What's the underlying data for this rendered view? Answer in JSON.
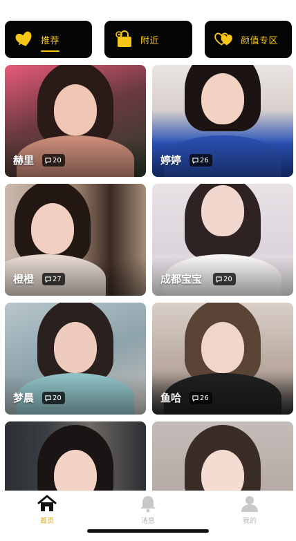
{
  "tabs": [
    {
      "label": "推荐",
      "icon": "heart-icon",
      "active": true
    },
    {
      "label": "附近",
      "icon": "location-bag-icon",
      "active": false
    },
    {
      "label": "颜值专区",
      "icon": "double-heart-icon",
      "active": false
    }
  ],
  "cards": [
    {
      "name": "赫里",
      "count": "20"
    },
    {
      "name": "婷婷",
      "count": "26"
    },
    {
      "name": "橙橙",
      "count": "27"
    },
    {
      "name": "成都宝宝",
      "count": "20"
    },
    {
      "name": "梦晨",
      "count": "20"
    },
    {
      "name": "鱼哈",
      "count": "26"
    },
    {
      "name": "",
      "count": ""
    },
    {
      "name": "",
      "count": ""
    }
  ],
  "bottom_nav": [
    {
      "label": "首页",
      "icon": "home-icon",
      "active": true
    },
    {
      "label": "消息",
      "icon": "bell-icon",
      "active": false
    },
    {
      "label": "我的",
      "icon": "user-icon",
      "active": false
    }
  ],
  "colors": {
    "accent": "#f5c518",
    "tab_bg": "#050505",
    "nav_active": "#d9a514",
    "nav_inactive": "#b8b8b8"
  }
}
